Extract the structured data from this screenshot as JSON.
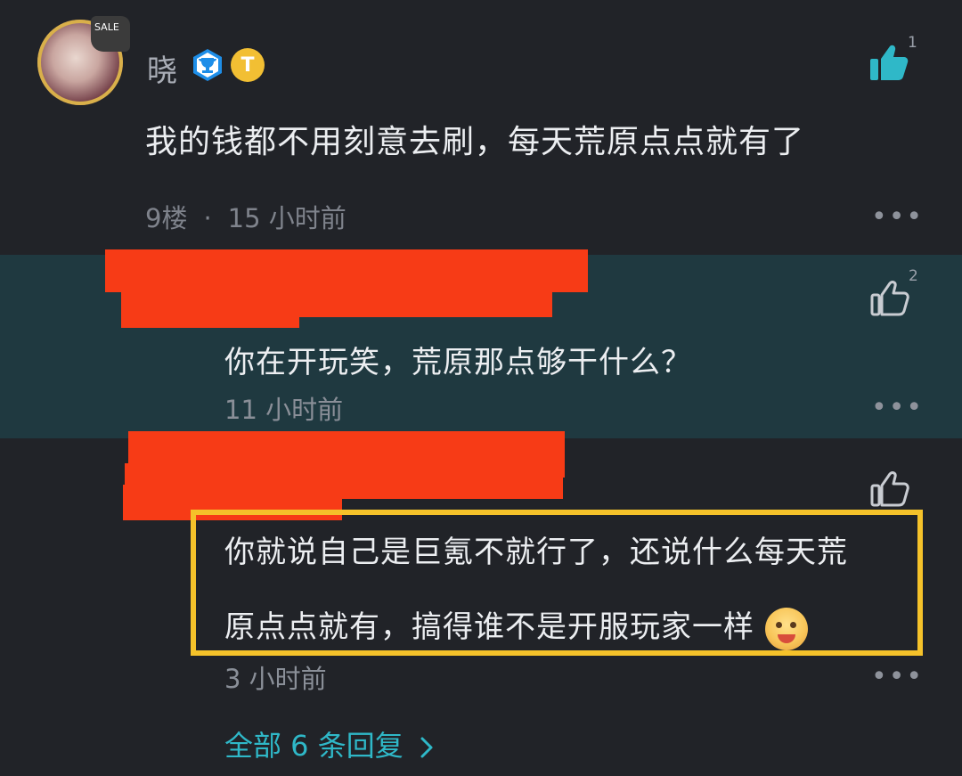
{
  "comment": {
    "username": "晓",
    "text": "我的钱都不用刻意去刷，每天荒原点点就有了",
    "floor": "9楼",
    "separator": "·",
    "time": "15 小时前",
    "likes": "1",
    "avatar_tag": "SALE"
  },
  "badges": {
    "trophy_icon": "trophy-badge-icon",
    "t_badge_label": "T"
  },
  "replies": [
    {
      "text": "你在开玩笑，荒原那点够干什么？",
      "time": "11 小时前",
      "likes": "2"
    },
    {
      "text_line1": "你就说自己是巨氪不就行了，还说什么每天荒",
      "text_line2": "原点点就有，搞得谁不是开服玩家一样",
      "time": "3 小时前",
      "likes": ""
    }
  ],
  "more_label": "•••",
  "all_replies": "全部 6 条回复",
  "colors": {
    "background": "#212328",
    "reply_band": "#1f3940",
    "accent_teal": "#2fb8c8",
    "redaction": "#f73b16",
    "highlight": "#f5c22a"
  }
}
